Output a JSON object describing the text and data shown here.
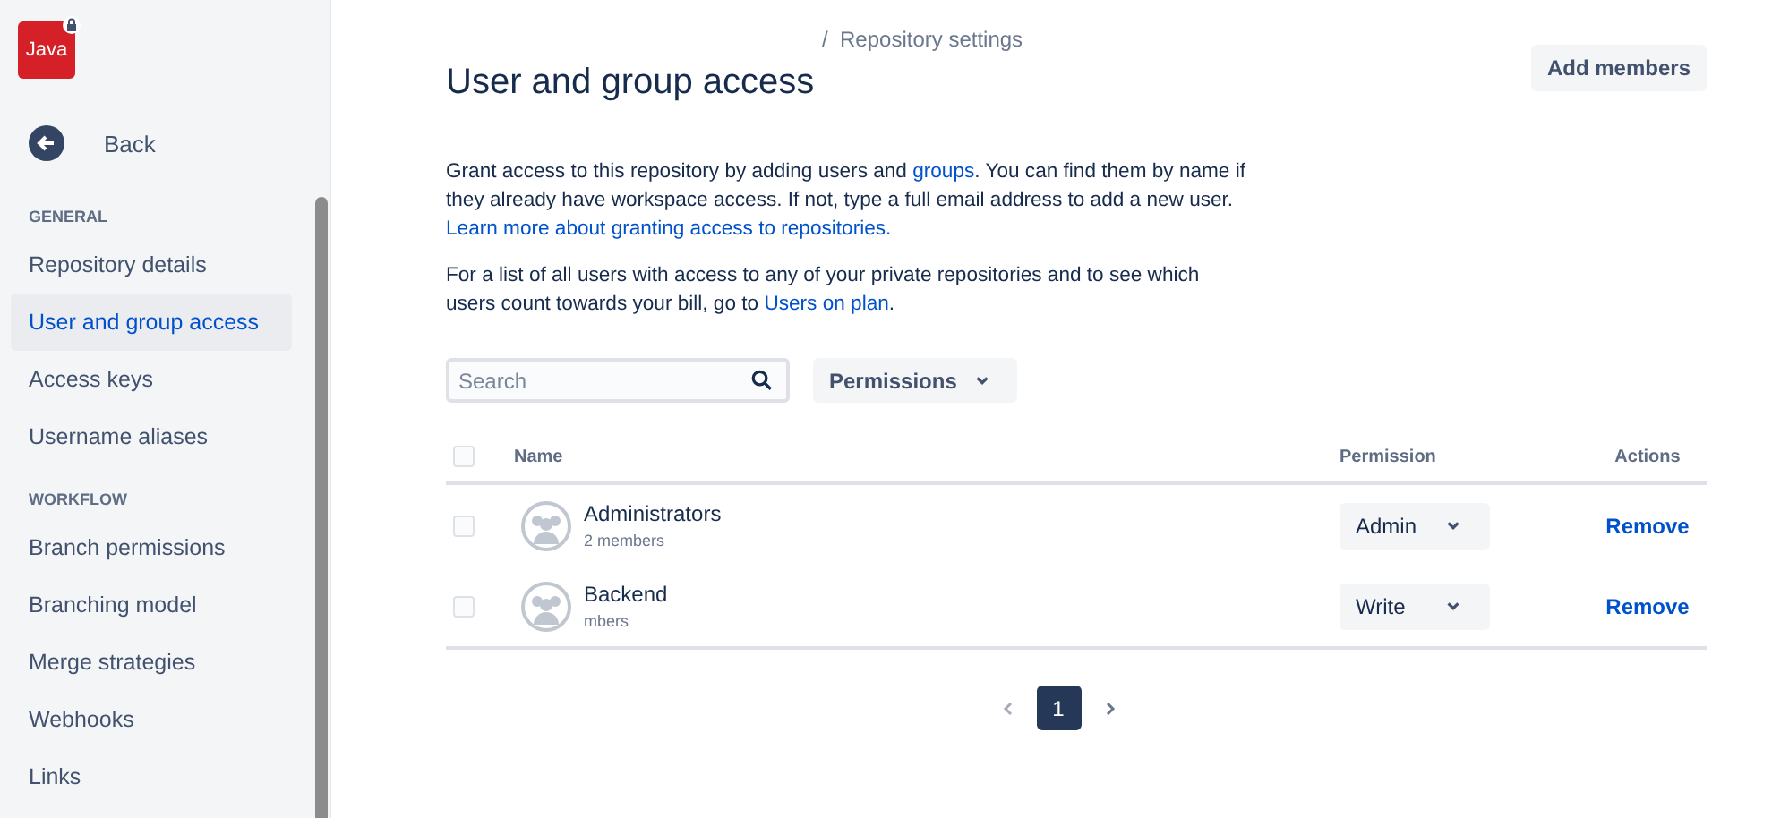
{
  "sidebar": {
    "logo": "Java",
    "back": "Back",
    "sections": [
      {
        "heading": "GENERAL",
        "items": [
          {
            "label": "Repository details",
            "selected": false
          },
          {
            "label": "User and group access",
            "selected": true
          },
          {
            "label": "Access keys",
            "selected": false
          },
          {
            "label": "Username aliases",
            "selected": false
          }
        ]
      },
      {
        "heading": "WORKFLOW",
        "items": [
          {
            "label": "Branch permissions",
            "selected": false
          },
          {
            "label": "Branching model",
            "selected": false
          },
          {
            "label": "Merge strategies",
            "selected": false
          },
          {
            "label": "Webhooks",
            "selected": false
          },
          {
            "label": "Links",
            "selected": false
          }
        ]
      }
    ]
  },
  "breadcrumb": {
    "separator": "/",
    "current": "Repository settings"
  },
  "title": "User and group access",
  "add_button": "Add members",
  "intro": [
    {
      "parts": [
        {
          "text": "Grant access to this repository by adding users and ",
          "link": false
        },
        {
          "text": "groups",
          "link": true
        },
        {
          "text": ". You can find them by name if they already have workspace access. If not, type a full email address to add a new user. ",
          "link": false
        },
        {
          "text": "Learn more about granting access to repositories.",
          "link": true
        }
      ]
    },
    {
      "parts": [
        {
          "text": "For a list of all users with access to any of your private repositories and to see which users count towards your bill, go to ",
          "link": false
        },
        {
          "text": "Users on plan",
          "link": true
        },
        {
          "text": ".",
          "link": false
        }
      ]
    }
  ],
  "search": {
    "placeholder": "Search"
  },
  "filter": "Permissions",
  "table": {
    "all_checked": false,
    "columns": [
      "Name",
      "Permission",
      "Actions"
    ],
    "rows": [
      {
        "name": "Administrators",
        "members": "2 members",
        "permission": "Admin",
        "action": "Remove",
        "checked": false
      },
      {
        "name": "Backend",
        "members": "mbers",
        "permission": "Write",
        "action": "Remove",
        "checked": false
      }
    ]
  },
  "pagination": {
    "pages": [
      {
        "label": "1",
        "selected": true
      }
    ]
  }
}
